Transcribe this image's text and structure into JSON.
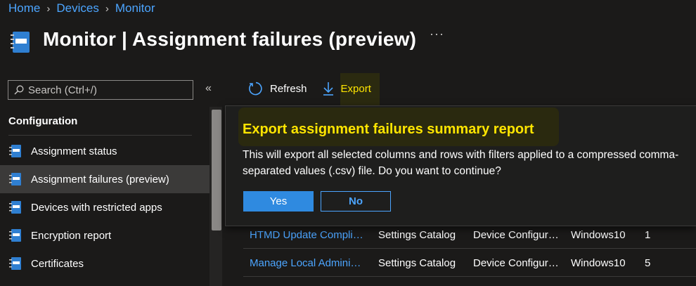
{
  "breadcrumb": {
    "items": [
      "Home",
      "Devices",
      "Monitor"
    ]
  },
  "header": {
    "title_bold": "Monitor",
    "title_rest": " | Assignment failures (preview)",
    "more": "···"
  },
  "search": {
    "placeholder": "Search (Ctrl+/)"
  },
  "sidebar": {
    "collapse": "«",
    "section": "Configuration",
    "items": [
      {
        "label": "Assignment status",
        "active": false
      },
      {
        "label": "Assignment failures (preview)",
        "active": true
      },
      {
        "label": "Devices with restricted apps",
        "active": false
      },
      {
        "label": "Encryption report",
        "active": false
      },
      {
        "label": "Certificates",
        "active": false
      }
    ]
  },
  "toolbar": {
    "refresh_label": "Refresh",
    "export_label": "Export"
  },
  "dialog": {
    "title": "Export assignment failures summary report",
    "message": "This will export all selected columns and rows with filters applied to a compressed comma-separated values (.csv) file. Do you want to continue?",
    "yes_label": "Yes",
    "no_label": "No"
  },
  "table": {
    "rows": [
      {
        "name": "HTMD Update Compli…",
        "type": "Settings Catalog",
        "category": "Device Configur…",
        "platform": "Windows10",
        "count": "1"
      },
      {
        "name": "Manage Local Admini…",
        "type": "Settings Catalog",
        "category": "Device Configur…",
        "platform": "Windows10",
        "count": "5"
      }
    ]
  },
  "colors": {
    "background": "#1b1a19",
    "link": "#4ca5ff",
    "highlight_text": "#ffe500",
    "primary_button": "#2f8ae0",
    "active_nav": "#3b3a39"
  }
}
